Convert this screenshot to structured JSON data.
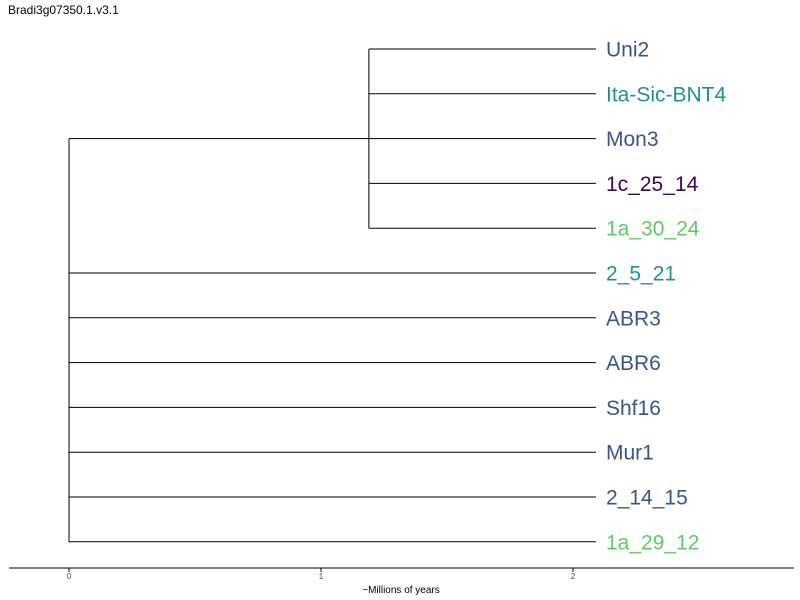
{
  "title": "Bradi3g07350.1.v3.1",
  "axis": {
    "label": "~Millions of years",
    "ticks": [
      "0",
      "1",
      "2"
    ]
  },
  "colors": {
    "blue": "#3b528b",
    "teal": "#21918c",
    "purple": "#440154",
    "green": "#5ec962",
    "branch": "#000000"
  },
  "tree": {
    "inner_node_depth": 1.19,
    "leaves": [
      {
        "name": "Uni2",
        "color": "#3b528b",
        "clade": "inner"
      },
      {
        "name": "Ita-Sic-BNT4",
        "color": "#21918c",
        "clade": "inner"
      },
      {
        "name": "Mon3",
        "color": "#3b528b",
        "clade": "inner"
      },
      {
        "name": "1c_25_14",
        "color": "#440154",
        "clade": "inner"
      },
      {
        "name": "1a_30_24",
        "color": "#5ec962",
        "clade": "inner"
      },
      {
        "name": "2_5_21",
        "color": "#21918c",
        "clade": "root"
      },
      {
        "name": "ABR3",
        "color": "#3b528b",
        "clade": "root"
      },
      {
        "name": "ABR6",
        "color": "#3b528b",
        "clade": "root"
      },
      {
        "name": "Shf16",
        "color": "#3b528b",
        "clade": "root"
      },
      {
        "name": "Mur1",
        "color": "#3b528b",
        "clade": "root"
      },
      {
        "name": "2_14_15",
        "color": "#3b528b",
        "clade": "root"
      },
      {
        "name": "1a_29_12",
        "color": "#5ec962",
        "clade": "root"
      }
    ]
  }
}
